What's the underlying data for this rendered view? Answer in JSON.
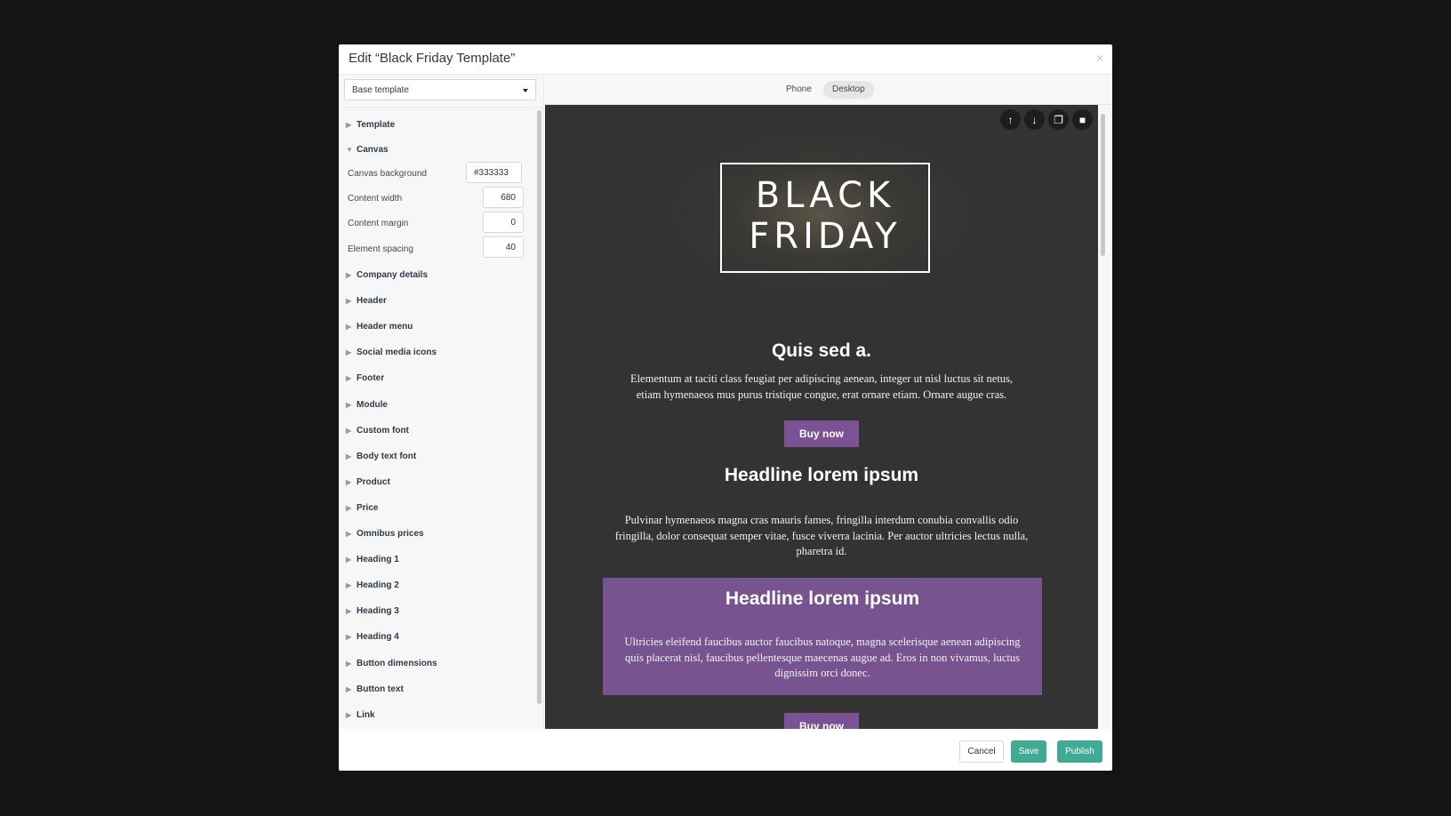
{
  "modal": {
    "title": "Edit “Black Friday Template”",
    "close_icon": "×"
  },
  "sidebar": {
    "template_select": {
      "value": "Base template"
    },
    "sections_top": [
      {
        "label": "Template",
        "expanded": false
      },
      {
        "label": "Canvas",
        "expanded": true
      }
    ],
    "canvas_fields": [
      {
        "label": "Canvas background",
        "value": "#333333"
      },
      {
        "label": "Content width",
        "value": "680"
      },
      {
        "label": "Content margin",
        "value": "0"
      },
      {
        "label": "Element spacing",
        "value": "40"
      }
    ],
    "sections": [
      {
        "label": "Company details"
      },
      {
        "label": "Header"
      },
      {
        "label": "Header menu"
      },
      {
        "label": "Social media icons"
      },
      {
        "label": "Footer"
      },
      {
        "label": "Module"
      },
      {
        "label": "Custom font"
      },
      {
        "label": "Body text font"
      },
      {
        "label": "Product"
      },
      {
        "label": "Price"
      },
      {
        "label": "Omnibus prices"
      },
      {
        "label": "Heading 1"
      },
      {
        "label": "Heading 2"
      },
      {
        "label": "Heading 3"
      },
      {
        "label": "Heading 4"
      },
      {
        "label": "Button dimensions"
      },
      {
        "label": "Button text"
      },
      {
        "label": "Link"
      }
    ]
  },
  "preview": {
    "tabs": [
      {
        "label": "Phone",
        "active": false
      },
      {
        "label": "Desktop",
        "active": true
      }
    ],
    "tools": [
      {
        "icon": "arrow-up-icon",
        "glyph": "↑"
      },
      {
        "icon": "arrow-down-icon",
        "glyph": "↓"
      },
      {
        "icon": "copy-icon",
        "glyph": "❐"
      },
      {
        "icon": "trash-icon",
        "glyph": "■"
      }
    ],
    "hero": {
      "line1": "BLACK",
      "line2": "FRIDAY"
    },
    "block1": {
      "heading": "Quis sed a.",
      "text": "Elementum at taciti class feugiat per adipiscing aenean, integer ut nisl luctus sit netus, etiam hymenaeos mus purus tristique congue, erat ornare etiam. Ornare augue cras.",
      "button": "Buy now"
    },
    "block2": {
      "heading": "Headline lorem ipsum",
      "text": "Pulvinar hymenaeos magna cras mauris fames, fringilla interdum conubia convallis odio fringilla, dolor consequat semper vitae, fusce viverra lacinia. Per auctor ultricies lectus nulla, pharetra id."
    },
    "block3": {
      "heading": "Headline lorem ipsum",
      "text": "Ultricies eleifend faucibus auctor faucibus natoque, magna scelerisque aenean adipiscing quis placerat nisl, faucibus pellentesque maecenas augue ad. Eros in non vivamus, luctus dignissim orci donec.",
      "button": "Buy now"
    },
    "colors": {
      "canvas": "#333333",
      "accent": "#77548f",
      "button": "#7b5294"
    }
  },
  "footer": {
    "cancel": "Cancel",
    "save": "Save",
    "publish": "Publish",
    "primary_color": "#3fab92"
  }
}
